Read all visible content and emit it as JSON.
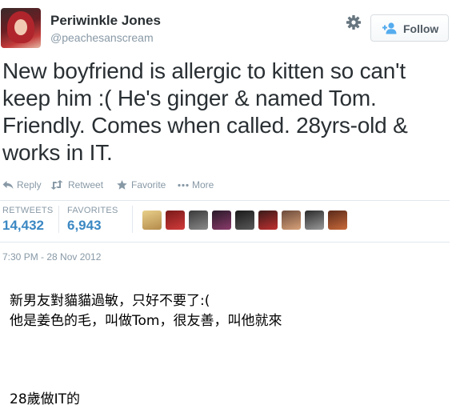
{
  "profile": {
    "name": "Periwinkle Jones",
    "handle": "@peachesanscream",
    "avatar_icon": "profile-photo"
  },
  "follow_label": "Follow",
  "tweet": {
    "text": "New boyfriend is allergic to kitten so can't keep him :( He's ginger & named Tom. Friendly. Comes when called. 28yrs-old & works in IT."
  },
  "actions": {
    "reply": "Reply",
    "retweet": "Retweet",
    "favorite": "Favorite",
    "more": "More"
  },
  "stats": {
    "retweets_label": "RETWEETS",
    "retweets_value": "14,432",
    "favorites_label": "FAVORITES",
    "favorites_value": "6,943"
  },
  "timestamp": "7:30 PM - 28 Nov 2012",
  "caption": {
    "line1": "新男友對貓貓過敏，只好不要了:(",
    "line2": "他是姜色的毛，叫做Tom，很友善，叫他就來",
    "line3": "28歲做IT的"
  },
  "colors": {
    "link_blue": "#3b88c3",
    "muted": "#8899a6",
    "text": "#292f33"
  }
}
